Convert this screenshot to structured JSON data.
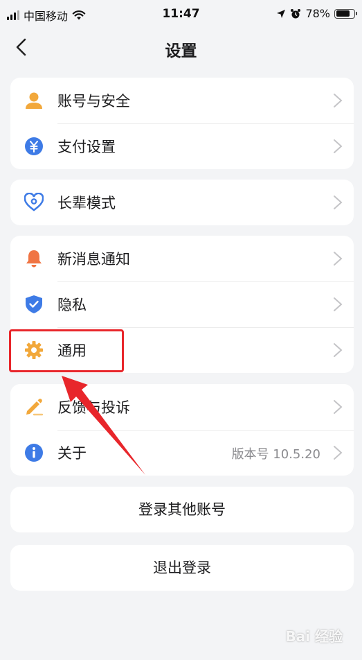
{
  "status_bar": {
    "carrier": "中国移动",
    "time": "11:47",
    "battery": "78%",
    "battery_level": 0.78
  },
  "nav": {
    "title": "设置",
    "back_icon": "chevron-left-icon"
  },
  "groups": [
    {
      "items": [
        {
          "label": "账号与安全",
          "icon": "person-icon",
          "color": "#f2a83b"
        },
        {
          "label": "支付设置",
          "icon": "yuan-icon",
          "color": "#3e7be6"
        }
      ]
    },
    {
      "items": [
        {
          "label": "长辈模式",
          "icon": "heart-icon",
          "color": "#3e7be6"
        }
      ]
    },
    {
      "items": [
        {
          "label": "新消息通知",
          "icon": "bell-icon",
          "color": "#f07443"
        },
        {
          "label": "隐私",
          "icon": "shield-icon",
          "color": "#3e7be6"
        },
        {
          "label": "通用",
          "icon": "gear-icon",
          "color": "#f2a83b"
        }
      ]
    },
    {
      "items": [
        {
          "label": "反馈与投诉",
          "icon": "pen-icon",
          "color": "#f2a83b"
        },
        {
          "label": "关于",
          "icon": "info-icon",
          "color": "#3e7be6",
          "value": "版本号 10.5.20"
        }
      ]
    }
  ],
  "buttons": {
    "switch_account": "登录其他账号",
    "logout": "退出登录"
  },
  "watermark": "Bai 经验",
  "annotation_color": "#e8262b"
}
